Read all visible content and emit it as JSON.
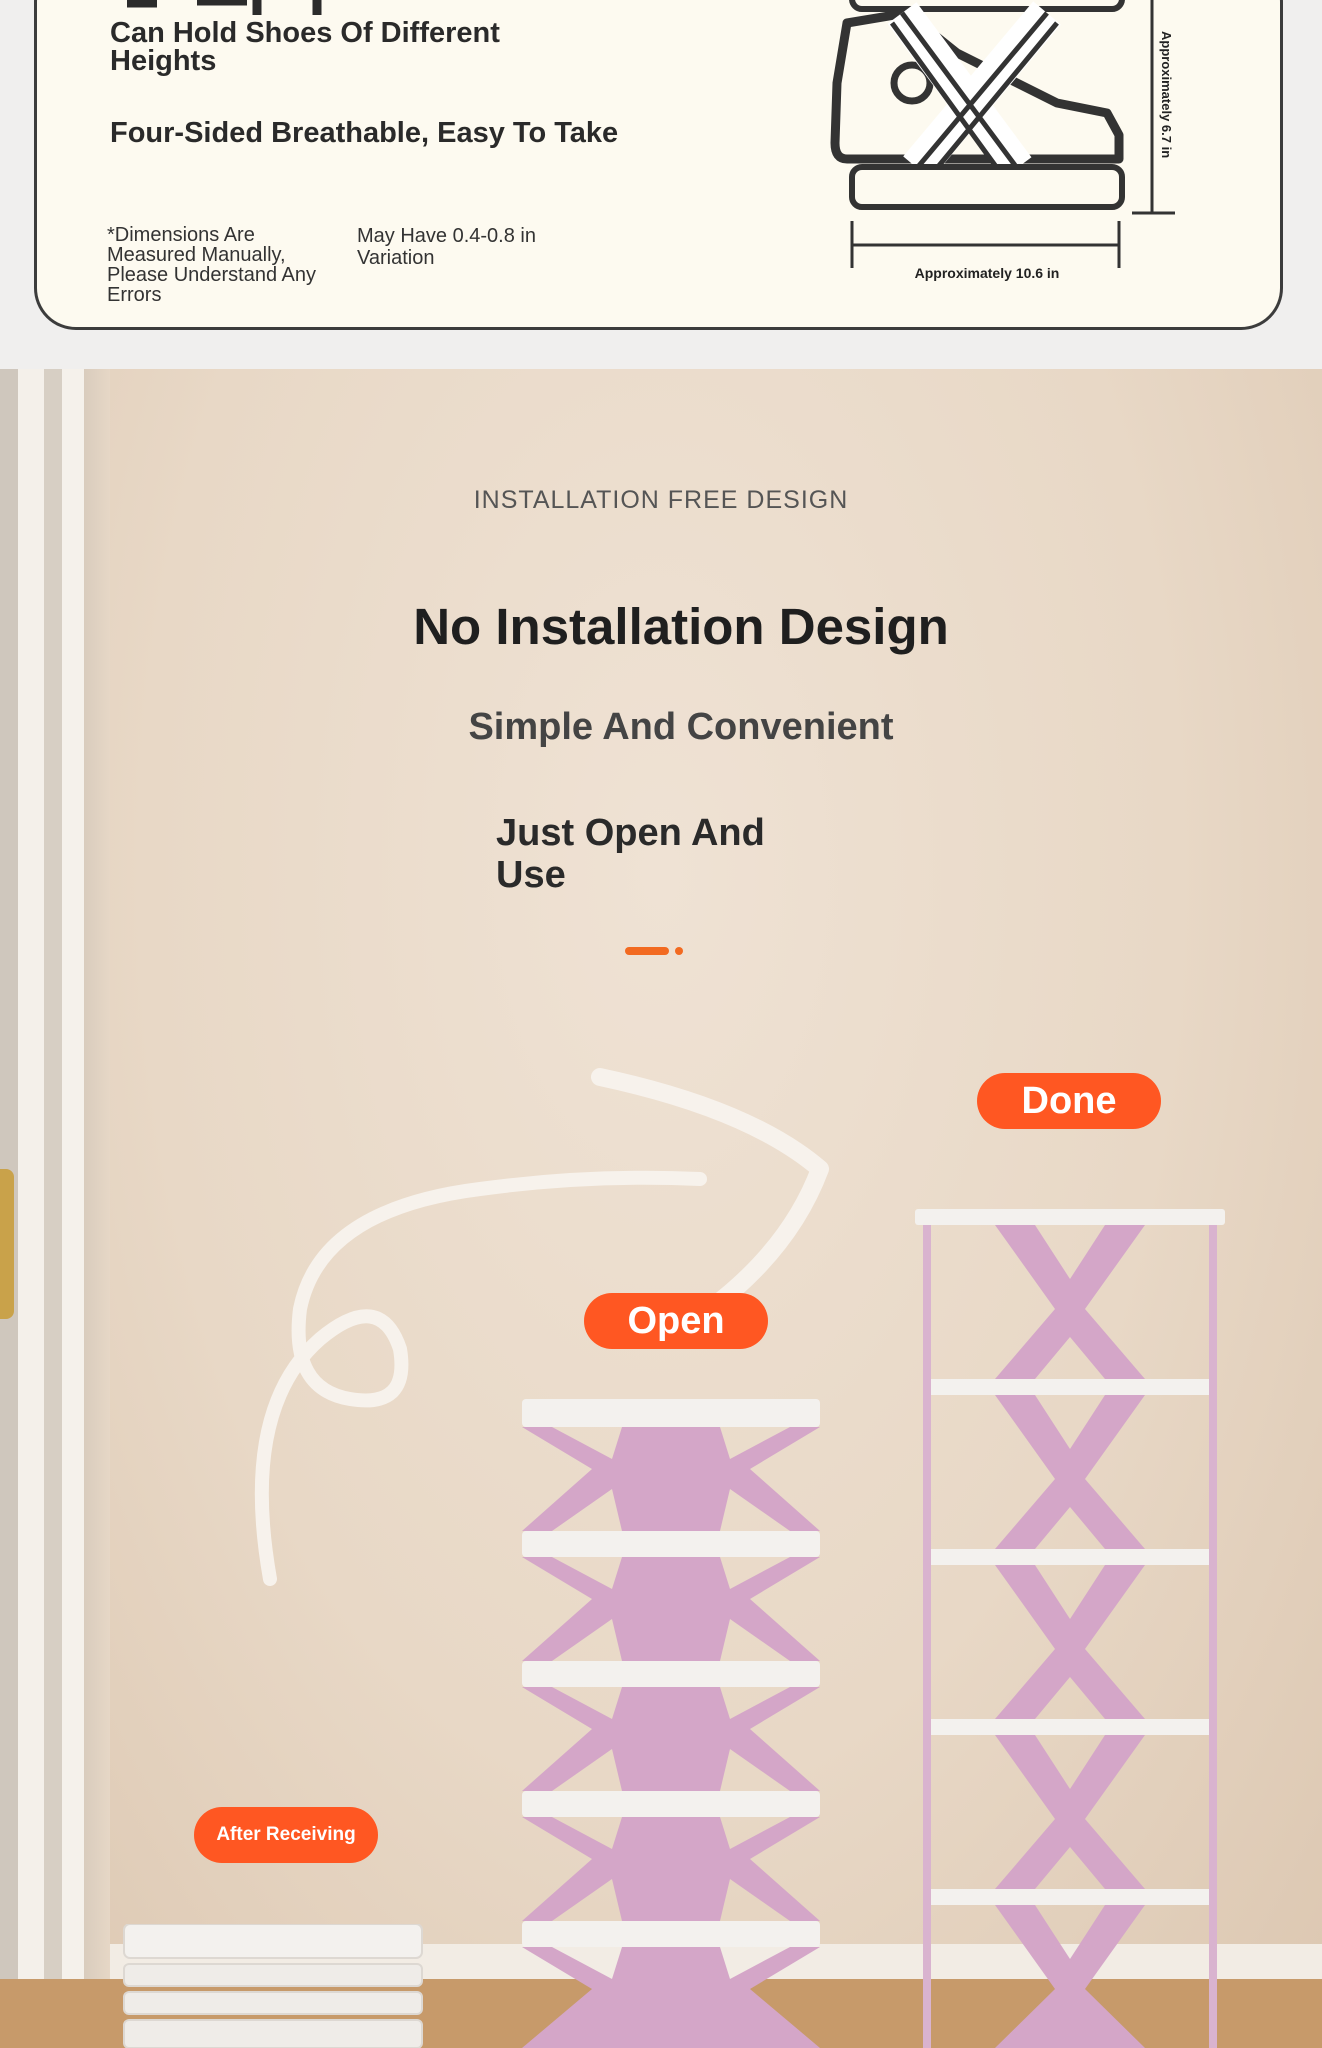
{
  "spec_card": {
    "shoes_heading": "Can Hold Shoes Of Different Heights",
    "breathable_heading": "Four-Sided Breathable, Easy To Take",
    "dimension_note": "*Dimensions Are Measured Manually, Please Understand Any Errors",
    "variation_note": "May Have 0.4-0.8 in Variation",
    "width_label": "Approximately 10.6 in",
    "height_label": "Approximately 6.7 in"
  },
  "installation": {
    "eyebrow": "INSTALLATION FREE DESIGN",
    "title": "No Installation Design",
    "subtitle": "Simple And Convenient",
    "tagline": "Just Open And Use",
    "steps": {
      "after_receiving": "After Receiving",
      "open": "Open",
      "done": "Done"
    }
  },
  "colors": {
    "accent": "#ff5722",
    "rack_pink": "#d4a6c8",
    "shelf_white": "#f3f1ee",
    "wall": "#e8d8c6"
  }
}
